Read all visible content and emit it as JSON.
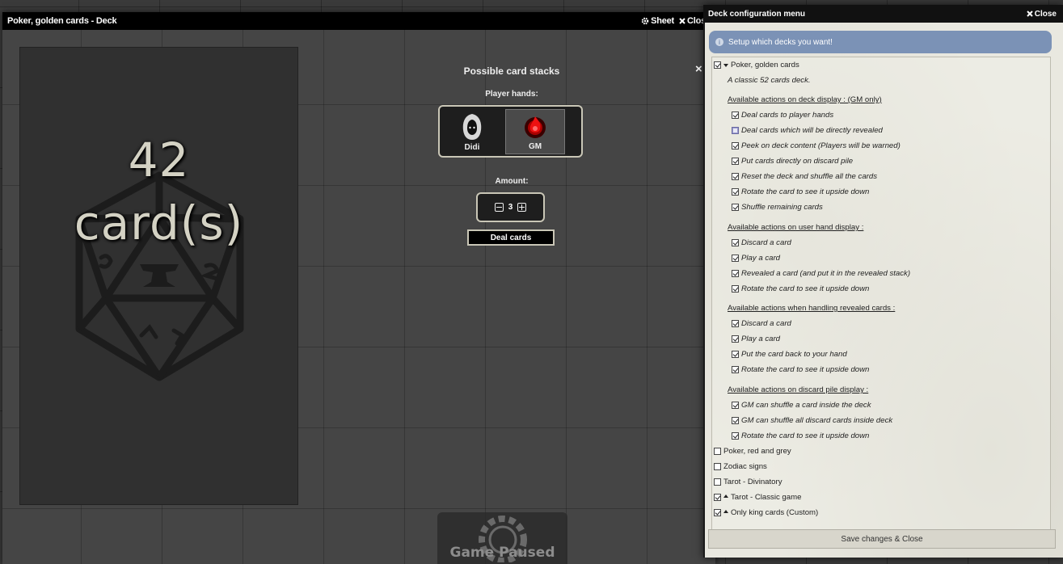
{
  "deck_window": {
    "title": "Poker, golden cards - Deck",
    "sheet_label": "Sheet",
    "close_label": "Close",
    "card_count": "42",
    "card_unit": "card(s)",
    "stacks_title": "Possible card stacks",
    "player_hands_label": "Player hands:",
    "players": [
      {
        "name": "Didi",
        "selected": false
      },
      {
        "name": "GM",
        "selected": true
      }
    ],
    "amount_label": "Amount:",
    "amount_value": "3",
    "deal_button": "Deal cards",
    "panel_close": "×"
  },
  "paused": {
    "text": "Game Paused"
  },
  "config_window": {
    "title": "Deck configuration menu",
    "close_label": "Close",
    "info": "Setup which decks you want!",
    "save_button": "Save changes & Close",
    "decks": [
      {
        "name": "Poker, golden cards",
        "checked": true,
        "expanded": true,
        "description": "A classic 52 cards deck.",
        "sections": [
          {
            "title": "Available actions on deck display : (GM only)",
            "options": [
              {
                "label": "Deal cards to player hands",
                "checked": true
              },
              {
                "label": "Deal cards which will be directly revealed",
                "checked": false
              },
              {
                "label": "Peek on deck content (Players will be warned)",
                "checked": true
              },
              {
                "label": "Put cards directly on discard pile",
                "checked": true
              },
              {
                "label": "Reset the deck and shuffle all the cards",
                "checked": true
              },
              {
                "label": "Rotate the card to see it upside down",
                "checked": true
              },
              {
                "label": "Shuffle remaining cards",
                "checked": true
              }
            ]
          },
          {
            "title": "Available actions on user hand display :",
            "options": [
              {
                "label": "Discard a card",
                "checked": true
              },
              {
                "label": "Play a card",
                "checked": true
              },
              {
                "label": "Revealed a card (and put it in the revealed stack)",
                "checked": true
              },
              {
                "label": "Rotate the card to see it upside down",
                "checked": true
              }
            ]
          },
          {
            "title": "Available actions when handling revealed cards :",
            "options": [
              {
                "label": "Discard a card",
                "checked": true
              },
              {
                "label": "Play a card",
                "checked": true
              },
              {
                "label": "Put the card back to your hand",
                "checked": true
              },
              {
                "label": "Rotate the card to see it upside down",
                "checked": true
              }
            ]
          },
          {
            "title": "Available actions on discard pile display :",
            "options": [
              {
                "label": "GM can shuffle a card inside the deck",
                "checked": true
              },
              {
                "label": "GM can shuffle all discard cards inside deck",
                "checked": true
              },
              {
                "label": "Rotate the card to see it upside down",
                "checked": true
              }
            ]
          }
        ]
      },
      {
        "name": "Poker, red and grey",
        "checked": false
      },
      {
        "name": "Zodiac signs",
        "checked": false
      },
      {
        "name": "Tarot - Divinatory",
        "checked": false
      },
      {
        "name": "Tarot - Classic game",
        "checked": true,
        "collapsible": true
      },
      {
        "name": "Only king cards (Custom)",
        "checked": true,
        "collapsible": true
      }
    ]
  }
}
